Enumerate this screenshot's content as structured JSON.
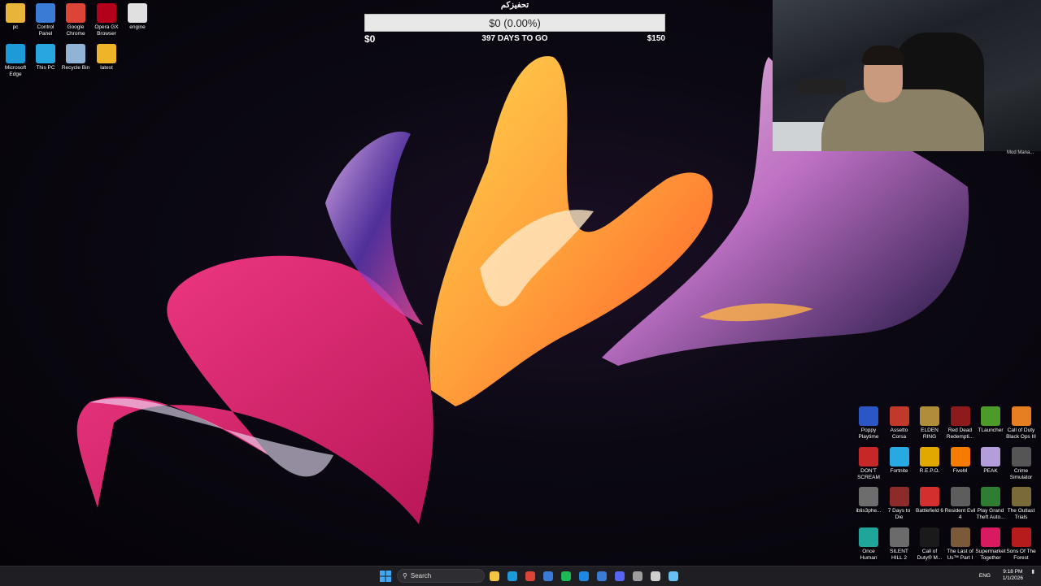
{
  "donation_widget": {
    "title": "تحفيزكم",
    "amount": "$0 (0.00%)",
    "progress": 0,
    "min_label": "$0",
    "days_label": "397 DAYS TO GO",
    "max_label": "$150"
  },
  "desktop_icons_left": [
    {
      "label": "pc",
      "icon": "folder-icon",
      "color": "#e8b43a"
    },
    {
      "label": "Control Panel",
      "icon": "control-panel-icon",
      "color": "#3a7bd5"
    },
    {
      "label": "Google Chrome",
      "icon": "chrome-icon",
      "color": "#db4437"
    },
    {
      "label": "Opera GX Browser",
      "icon": "opera-gx-icon",
      "color": "#b3001b"
    },
    {
      "label": "engine",
      "icon": "file-icon",
      "color": "#e0e0e0"
    },
    {
      "label": "Microsoft Edge",
      "icon": "edge-icon",
      "color": "#1c9bd8"
    },
    {
      "label": "This PC",
      "icon": "monitor-icon",
      "color": "#28a6e0"
    },
    {
      "label": "Recycle Bin",
      "icon": "recycle-bin-icon",
      "color": "#8fb4d6"
    },
    {
      "label": "latest",
      "icon": "zip-folder-icon",
      "color": "#f0b429"
    }
  ],
  "desktop_icons_right": [
    {
      "label": "Poppy Playtime",
      "icon": "poppy-playtime-icon",
      "color": "#2a56c6"
    },
    {
      "label": "Assetto Corsa",
      "icon": "assetto-corsa-icon",
      "color": "#c0392b"
    },
    {
      "label": "ELDEN RING",
      "icon": "elden-ring-icon",
      "color": "#b08d3a"
    },
    {
      "label": "Red Dead Redempti...",
      "icon": "red-dead-icon",
      "color": "#8e1b1b"
    },
    {
      "label": "TLauncher",
      "icon": "tlauncher-icon",
      "color": "#4c9a2a"
    },
    {
      "label": "Call of Duty Black Ops III",
      "icon": "cod-bo3-icon",
      "color": "#e67e22"
    },
    {
      "label": "DON'T SCREAM",
      "icon": "dont-scream-icon",
      "color": "#c62828"
    },
    {
      "label": "Fortnite",
      "icon": "fortnite-icon",
      "color": "#29a9e1"
    },
    {
      "label": "R.E.P.O.",
      "icon": "repo-icon",
      "color": "#e0a800"
    },
    {
      "label": "FiveM",
      "icon": "fivem-icon",
      "color": "#f57c00"
    },
    {
      "label": "PEAK",
      "icon": "peak-icon",
      "color": "#b39ddb"
    },
    {
      "label": "Crime Simulator",
      "icon": "crime-simulator-icon",
      "color": "#555555"
    },
    {
      "label": "iblis3phe...",
      "icon": "iblis-icon",
      "color": "#6d6d6d"
    },
    {
      "label": "7 Days to Die",
      "icon": "7-days-to-die-icon",
      "color": "#8d2a2a"
    },
    {
      "label": "Battlefield 6",
      "icon": "battlefield-icon",
      "color": "#d32f2f"
    },
    {
      "label": "Resident Evil 4",
      "icon": "resident-evil-icon",
      "color": "#5d5d5d"
    },
    {
      "label": "Play Grand Theft Auto...",
      "icon": "gta-icon",
      "color": "#2e7d32"
    },
    {
      "label": "The Outlast Trials",
      "icon": "outlast-trials-icon",
      "color": "#7a6a3a"
    },
    {
      "label": "Once Human",
      "icon": "once-human-icon",
      "color": "#1fa59a"
    },
    {
      "label": "SILENT HILL 2",
      "icon": "silent-hill-icon",
      "color": "#6b6b6b"
    },
    {
      "label": "Call of Duty® M...",
      "icon": "cod-mw-icon",
      "color": "#1a1a1a"
    },
    {
      "label": "The Last of Us™ Part I",
      "icon": "last-of-us-icon",
      "color": "#7b5a3a"
    },
    {
      "label": "Supermarket Together",
      "icon": "supermarket-together-icon",
      "color": "#d81b60"
    },
    {
      "label": "Sons Of The Forest",
      "icon": "sons-of-the-forest-icon",
      "color": "#b71c1c"
    }
  ],
  "webcam": {
    "overlay_label": "Mod Mana..."
  },
  "taskbar": {
    "search_label": "Search",
    "apps": [
      {
        "icon": "file-explorer-icon",
        "color": "#f4c542"
      },
      {
        "icon": "edge-icon",
        "color": "#1c9bd8"
      },
      {
        "icon": "chrome-icon",
        "color": "#db4437"
      },
      {
        "icon": "store-icon",
        "color": "#3a7bd5"
      },
      {
        "icon": "spotify-icon",
        "color": "#1db954"
      },
      {
        "icon": "app-window-icon",
        "color": "#1e88e5"
      },
      {
        "icon": "app-square-icon",
        "color": "#3a7bd5"
      },
      {
        "icon": "discord-icon",
        "color": "#5865f2"
      },
      {
        "icon": "terminal-icon",
        "color": "#9e9e9e"
      },
      {
        "icon": "obs-icon",
        "color": "#d0d0d0"
      },
      {
        "icon": "steam-icon",
        "color": "#66c0f4"
      }
    ],
    "language": "ENG",
    "time": "9:18 PM",
    "date": "1/1/2026"
  }
}
